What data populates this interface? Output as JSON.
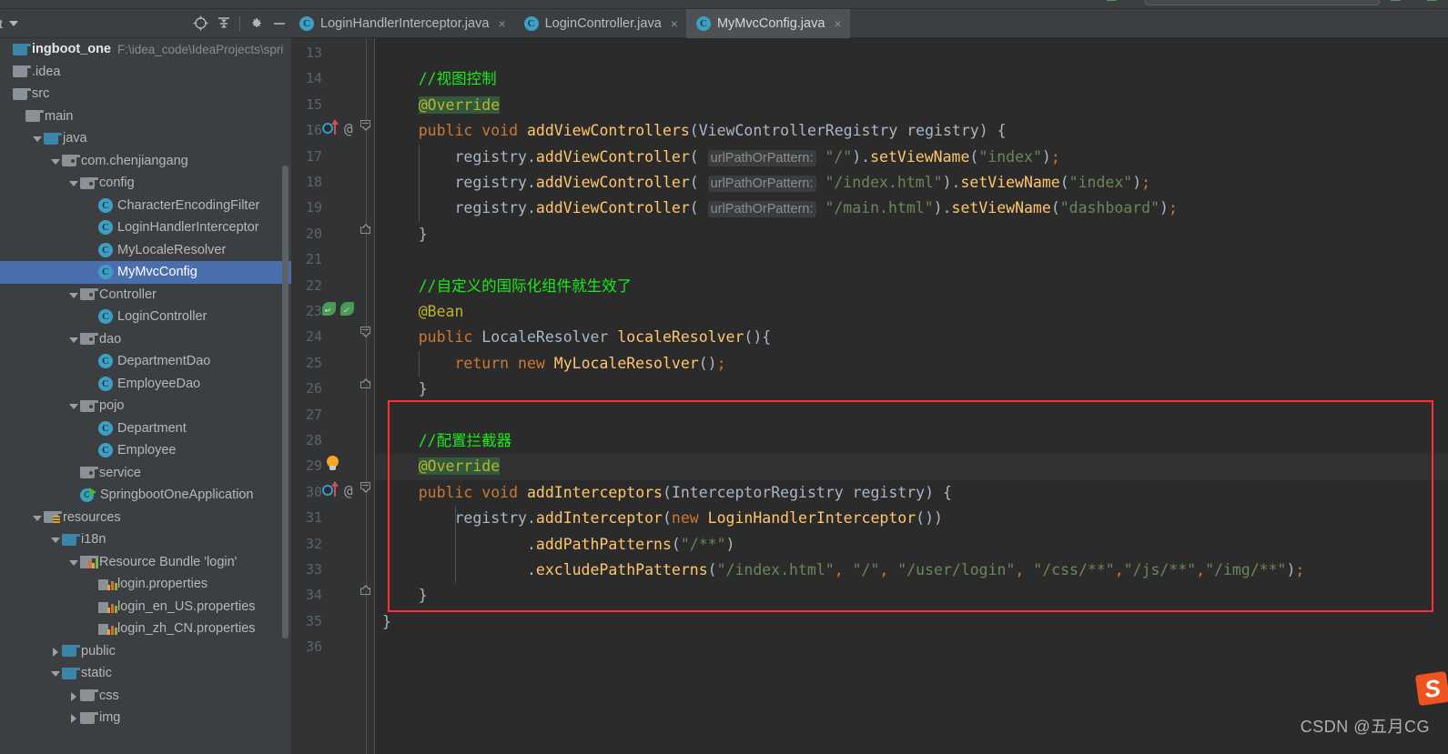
{
  "window": {
    "app": "IntelliJ IDEA",
    "theme_bg": "#3c3f41",
    "editor_bg": "#2b2b2b",
    "accent_selection": "#4b6eaf",
    "highlight_box_color": "#ff2f2f"
  },
  "project_panel": {
    "title": "ct",
    "icons": {
      "locate": "crosshair-icon",
      "collapse": "collapse-all-icon",
      "settings": "gear-icon",
      "minimize": "minimize-icon"
    },
    "tree": [
      {
        "label": "ingboot_one",
        "path": "F:\\idea_code\\IdeaProjects\\spri",
        "indent": 0,
        "icon": "project-root",
        "twisty": "",
        "kind": "root"
      },
      {
        "label": ".idea",
        "indent": 1,
        "icon": "folder",
        "twisty": "",
        "kind": "folder"
      },
      {
        "label": "src",
        "indent": 1,
        "icon": "folder",
        "twisty": "",
        "kind": "folder"
      },
      {
        "label": "main",
        "indent": 2,
        "icon": "folder",
        "twisty": "",
        "kind": "folder"
      },
      {
        "label": "java",
        "indent": 3,
        "icon": "folder-source",
        "twisty": "open",
        "kind": "folder-blue"
      },
      {
        "label": "com.chenjiangang",
        "indent": 4,
        "icon": "package",
        "twisty": "open",
        "kind": "package"
      },
      {
        "label": "config",
        "indent": 5,
        "icon": "package",
        "twisty": "open",
        "kind": "package"
      },
      {
        "label": "CharacterEncodingFilter",
        "indent": 6,
        "icon": "java-class",
        "twisty": "",
        "kind": "class"
      },
      {
        "label": "LoginHandlerInterceptor",
        "indent": 6,
        "icon": "java-class",
        "twisty": "",
        "kind": "class"
      },
      {
        "label": "MyLocaleResolver",
        "indent": 6,
        "icon": "java-class",
        "twisty": "",
        "kind": "class"
      },
      {
        "label": "MyMvcConfig",
        "indent": 6,
        "icon": "java-class",
        "twisty": "",
        "kind": "class",
        "selected": true
      },
      {
        "label": "Controller",
        "indent": 5,
        "icon": "package",
        "twisty": "open",
        "kind": "package"
      },
      {
        "label": "LoginController",
        "indent": 6,
        "icon": "java-class",
        "twisty": "",
        "kind": "class"
      },
      {
        "label": "dao",
        "indent": 5,
        "icon": "package",
        "twisty": "open",
        "kind": "package"
      },
      {
        "label": "DepartmentDao",
        "indent": 6,
        "icon": "java-class",
        "twisty": "",
        "kind": "class"
      },
      {
        "label": "EmployeeDao",
        "indent": 6,
        "icon": "java-class",
        "twisty": "",
        "kind": "class"
      },
      {
        "label": "pojo",
        "indent": 5,
        "icon": "package",
        "twisty": "open",
        "kind": "package"
      },
      {
        "label": "Department",
        "indent": 6,
        "icon": "java-class",
        "twisty": "",
        "kind": "class"
      },
      {
        "label": "Employee",
        "indent": 6,
        "icon": "java-class",
        "twisty": "",
        "kind": "class"
      },
      {
        "label": "service",
        "indent": 5,
        "icon": "package",
        "twisty": "",
        "kind": "package"
      },
      {
        "label": "SpringbootOneApplication",
        "indent": 5,
        "icon": "spring-boot-app",
        "twisty": "",
        "kind": "spring"
      },
      {
        "label": "resources",
        "indent": 3,
        "icon": "folder-resources",
        "twisty": "open",
        "kind": "folder-res"
      },
      {
        "label": "i18n",
        "indent": 4,
        "icon": "folder",
        "twisty": "open",
        "kind": "folder-blue"
      },
      {
        "label": "Resource Bundle 'login'",
        "indent": 5,
        "icon": "resource-bundle",
        "twisty": "open",
        "kind": "bundle"
      },
      {
        "label": "login.properties",
        "indent": 6,
        "icon": "properties-file",
        "twisty": "",
        "kind": "props"
      },
      {
        "label": "login_en_US.properties",
        "indent": 6,
        "icon": "properties-file",
        "twisty": "",
        "kind": "props"
      },
      {
        "label": "login_zh_CN.properties",
        "indent": 6,
        "icon": "properties-file",
        "twisty": "",
        "kind": "props"
      },
      {
        "label": "public",
        "indent": 4,
        "icon": "folder",
        "twisty": "closed",
        "kind": "folder-blue"
      },
      {
        "label": "static",
        "indent": 4,
        "icon": "folder",
        "twisty": "open",
        "kind": "folder-blue"
      },
      {
        "label": "css",
        "indent": 5,
        "icon": "folder",
        "twisty": "closed",
        "kind": "folder"
      },
      {
        "label": "img",
        "indent": 5,
        "icon": "folder",
        "twisty": "closed",
        "kind": "folder"
      }
    ]
  },
  "editor": {
    "tabs": [
      {
        "label": "LoginHandlerInterceptor.java",
        "icon": "java-class",
        "active": false,
        "close": "×"
      },
      {
        "label": "LoginController.java",
        "icon": "java-class",
        "active": false,
        "close": "×"
      },
      {
        "label": "MyMvcConfig.java",
        "icon": "java-class",
        "active": true,
        "close": "×"
      }
    ],
    "first_line_number": 13,
    "lines": [
      {
        "n": "13",
        "text": ""
      },
      {
        "n": "14",
        "text": "    //视图控制"
      },
      {
        "n": "15",
        "text": "    @Override"
      },
      {
        "n": "16",
        "text": "    public void addViewControllers(ViewControllerRegistry registry) {"
      },
      {
        "n": "17",
        "text": "        registry.addViewController( urlPathOrPattern: \"/\").setViewName(\"index\");"
      },
      {
        "n": "18",
        "text": "        registry.addViewController( urlPathOrPattern: \"/index.html\").setViewName(\"index\");"
      },
      {
        "n": "19",
        "text": "        registry.addViewController( urlPathOrPattern: \"/main.html\").setViewName(\"dashboard\");"
      },
      {
        "n": "20",
        "text": "    }"
      },
      {
        "n": "21",
        "text": ""
      },
      {
        "n": "22",
        "text": "    //自定义的国际化组件就生效了"
      },
      {
        "n": "23",
        "text": "    @Bean"
      },
      {
        "n": "24",
        "text": "    public LocaleResolver localeResolver(){"
      },
      {
        "n": "25",
        "text": "        return new MyLocaleResolver();"
      },
      {
        "n": "26",
        "text": "    }"
      },
      {
        "n": "27",
        "text": ""
      },
      {
        "n": "28",
        "text": "    //配置拦截器"
      },
      {
        "n": "29",
        "text": "    @Override"
      },
      {
        "n": "30",
        "text": "    public void addInterceptors(InterceptorRegistry registry) {"
      },
      {
        "n": "31",
        "text": "        registry.addInterceptor(new LoginHandlerInterceptor())"
      },
      {
        "n": "32",
        "text": "                .addPathPatterns(\"/**\")"
      },
      {
        "n": "33",
        "text": "                .excludePathPatterns(\"/index.html\", \"/\", \"/user/login\", \"/css/**\",\"/js/**\",\"/img/**\");"
      },
      {
        "n": "34",
        "text": "    }"
      },
      {
        "n": "35",
        "text": "}"
      },
      {
        "n": "36",
        "text": ""
      }
    ],
    "gutter_icons": [
      {
        "line": "16",
        "icons": [
          "override-method-icon",
          "annotation-at-icon",
          "fold-start-icon"
        ]
      },
      {
        "line": "20",
        "icons": [
          "fold-end-icon"
        ]
      },
      {
        "line": "23",
        "icons": [
          "spring-bean-icon",
          "spring-bean-navigate-icon"
        ]
      },
      {
        "line": "24",
        "icons": [
          "fold-start-icon"
        ]
      },
      {
        "line": "26",
        "icons": [
          "fold-end-icon"
        ]
      },
      {
        "line": "29",
        "icons": [
          "intention-lightbulb-icon"
        ]
      },
      {
        "line": "30",
        "icons": [
          "override-method-icon",
          "annotation-at-icon",
          "fold-start-icon"
        ]
      },
      {
        "line": "34",
        "icons": [
          "fold-end-icon"
        ]
      }
    ],
    "annotation_highlight": "@Override",
    "red_box": {
      "from_line": "27",
      "to_line": "34",
      "color": "#ff2f2f"
    }
  },
  "watermark": {
    "text": "CSDN @五月CG",
    "ime_icon": "sogou-ime-icon",
    "ime_glyph": "S"
  }
}
